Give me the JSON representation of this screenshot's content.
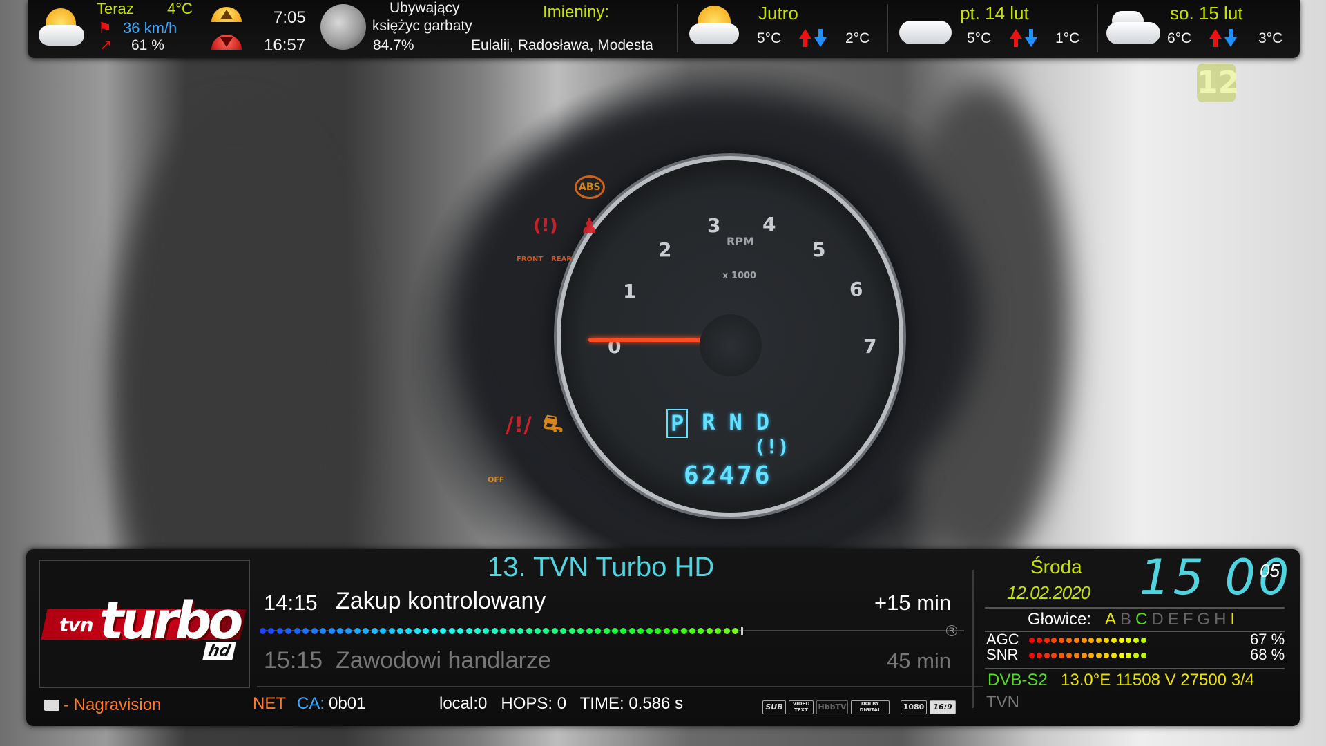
{
  "topbar": {
    "now_label": "Teraz",
    "now_temp": "4°C",
    "wind": "36 km/h",
    "humidity": "61 %",
    "sunrise": "7:05",
    "sunset": "16:57",
    "moon_phase_line1": "Ubywający",
    "moon_phase_line2": "księżyc garbaty",
    "moon_illum": "84.7%",
    "nameday_label": "Imieniny:",
    "nameday_names": "Eulalii, Radosława, Modesta",
    "forecast": [
      {
        "label": "Jutro",
        "high": "5°C",
        "low": "2°C",
        "icon": "sun-cloud-icon"
      },
      {
        "label": "pt. 14 lut",
        "high": "5°C",
        "low": "1°C",
        "icon": "cloud-icon"
      },
      {
        "label": "so. 15 lut",
        "high": "6°C",
        "low": "3°C",
        "icon": "cloud-icon"
      }
    ]
  },
  "video": {
    "channel_badge": "12",
    "gauge_numbers": [
      "0",
      "1",
      "2",
      "3",
      "4",
      "5",
      "6",
      "7"
    ],
    "gauge_unit": "RPM",
    "gauge_scale": "x 1000",
    "gear_display": [
      "P",
      "R",
      "N",
      "D"
    ],
    "odometer": "62476",
    "warn_abs": "ABS",
    "warn_front": "FRONT",
    "warn_rear": "REAR",
    "warn_off": "OFF"
  },
  "infobar": {
    "channel_title": "13. TVN Turbo HD",
    "logo": {
      "tvn": "tvn",
      "turbo": "turbo",
      "hd": "hd"
    },
    "current": {
      "time": "14:15",
      "title": "Zakup kontrolowany",
      "remaining": "+15 min",
      "progress": 0.75
    },
    "next": {
      "time": "15:15",
      "title": "Zawodowi handlarze",
      "duration": "45 min"
    },
    "rec_mark": "R",
    "encryption": "- Nagravision",
    "net_label": "NET",
    "ca_label": "CA:",
    "ca_value": "0b01",
    "stream_info": "local:0   HOPS: 0   TIME: 0.586 s",
    "format_badges": [
      "SUB",
      "VIDEO TEXT",
      "HbbTV",
      "DOLBY DIGITAL",
      "1080",
      "16:9"
    ],
    "day": "Środa",
    "date": "12.02.2020",
    "clock_hm": "15 00",
    "clock_sec": "05",
    "heads_label": "Głowice:",
    "heads": [
      "A",
      "B",
      "C",
      "D",
      "E",
      "F",
      "G",
      "H",
      "I"
    ],
    "agc_label": "AGC",
    "agc_value": "67 %",
    "agc_level": 0.67,
    "snr_label": "SNR",
    "snr_value": "68 %",
    "snr_level": 0.68,
    "tuner_system": "DVB-S2",
    "tuner_params": "13.0°E 11508 V 27500 3/4",
    "provider": "TVN",
    "colors": {
      "cyan": "#4fd4e0",
      "green": "#55dd22",
      "yellow": "#e8e000",
      "orange": "#ff7a2a"
    }
  }
}
